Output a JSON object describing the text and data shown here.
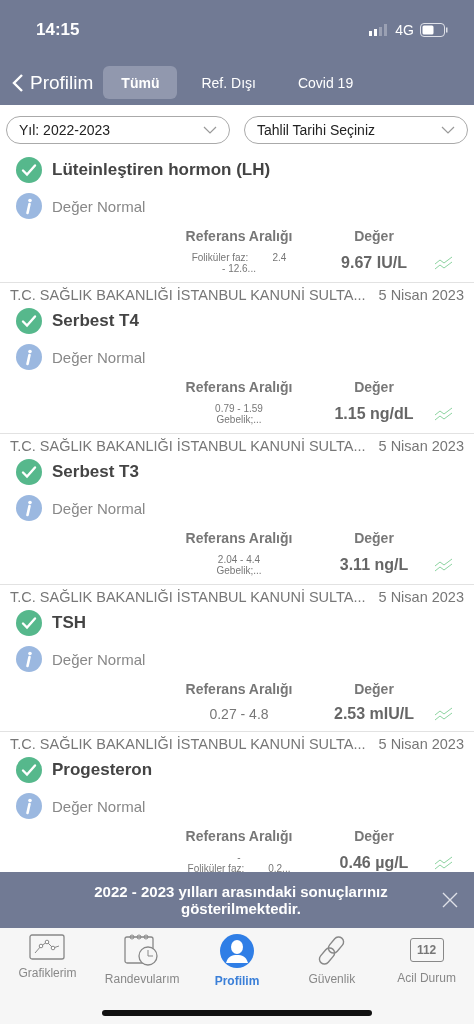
{
  "status_bar": {
    "time": "14:15",
    "network": "4G"
  },
  "nav": {
    "back_label": "Profilim",
    "tabs": [
      {
        "label": "Tümü",
        "selected": true
      },
      {
        "label": "Ref. Dışı",
        "selected": false
      },
      {
        "label": "Covid 19",
        "selected": false
      }
    ]
  },
  "filters": [
    {
      "value": "Yıl: 2022-2023"
    },
    {
      "value": "Tahlil Tarihi Seçiniz"
    }
  ],
  "results": [
    {
      "title": "Lüteinleştiren hormon (LH)",
      "status": "Değer Normal",
      "normal": true,
      "ref_header": "Referans Aralığı",
      "value_header": "Değer",
      "ref_lines": [
        [
          "Foliküler faz:",
          "2.4"
        ],
        [
          "- 12.6..."
        ]
      ],
      "value": "9.67 IU/L"
    },
    {
      "institution": "T.C. SAĞLIK BAKANLIĞI İSTANBUL KANUNİ SULTA...",
      "date": "5 Nisan 2023",
      "title": "Serbest T4",
      "status": "Değer Normal",
      "normal": true,
      "ref_header": "Referans Aralığı",
      "value_header": "Değer",
      "ref_lines": [
        [
          "0.79 - 1.59"
        ],
        [
          "Gebelik;..."
        ]
      ],
      "value": "1.15 ng/dL"
    },
    {
      "institution": "T.C. SAĞLIK BAKANLIĞI İSTANBUL KANUNİ SULTA...",
      "date": "5 Nisan 2023",
      "title": "Serbest T3",
      "status": "Değer Normal",
      "normal": true,
      "ref_header": "Referans Aralığı",
      "value_header": "Değer",
      "ref_lines": [
        [
          "2.04 - 4.4"
        ],
        [
          "Gebelik;..."
        ]
      ],
      "value": "3.11 ng/L"
    },
    {
      "institution": "T.C. SAĞLIK BAKANLIĞI İSTANBUL KANUNİ SULTA...",
      "date": "5 Nisan 2023",
      "title": "TSH",
      "status": "Değer Normal",
      "normal": true,
      "ref_header": "Referans Aralığı",
      "value_header": "Değer",
      "ref_lines": [
        [
          "0.27 - 4.8"
        ]
      ],
      "value": "2.53 mIU/L"
    },
    {
      "institution": "T.C. SAĞLIK BAKANLIĞI İSTANBUL KANUNİ SULTA...",
      "date": "5 Nisan 2023",
      "title": "Progesteron",
      "status": "Değer Normal",
      "normal": true,
      "ref_header": "Referans Aralığı",
      "value_header": "Değer",
      "ref_lines": [
        [
          "-"
        ],
        [
          "Foliküler faz:",
          "0.2..."
        ]
      ],
      "value": "0.46 µg/L"
    }
  ],
  "banner": {
    "message": "2022 - 2023 yılları arasındaki sonuçlarınız gösterilmektedir."
  },
  "tab_bar": [
    {
      "kind": "chart",
      "label": "Grafiklerim",
      "selected": false
    },
    {
      "kind": "calendar",
      "label": "Randevularım",
      "selected": false
    },
    {
      "kind": "profile",
      "label": "Profilim",
      "selected": true
    },
    {
      "kind": "link",
      "label": "Güvenlik",
      "selected": false
    },
    {
      "kind": "emergency",
      "label": "Acil Durum",
      "badge": "112",
      "selected": false
    }
  ]
}
